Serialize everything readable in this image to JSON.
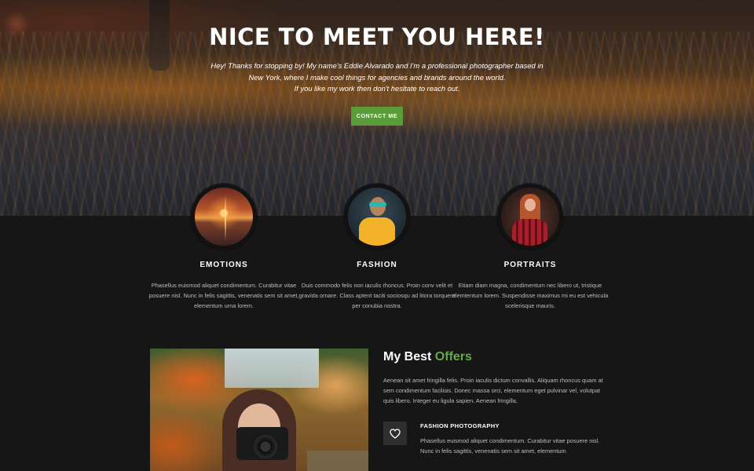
{
  "hero": {
    "title": "NICE TO MEET YOU HERE!",
    "text_lines": [
      "Hey! Thanks for stopping by! My name's Eddie Alvarado and I'm a professional photographer based in",
      "New York, where I make cool things for agencies and brands around the world.",
      "If you like my work then don't hesitate to reach out."
    ],
    "button_label": "CONTACT ME"
  },
  "features": [
    {
      "title": "EMOTIONS",
      "text": "Phasellus euismod aliquet condimentum. Curabitur vitae posuere nisl. Nunc in felis sagittis, venenatis sem sit amet, elementum urna lorem."
    },
    {
      "title": "FASHION",
      "text": "Duis commodo felis non iaculis rhoncus. Proin conv velit et gravida ornare. Class aptent taciti sociosqu ad litora torquent per conubia nostra."
    },
    {
      "title": "PORTRAITS",
      "text": "Etiam diam magna, condimentum nec libero ut, tristique elemtentum lorem. Suspendisse maximus mi eu est vehicula scelerisque mauris."
    }
  ],
  "offers": {
    "title_prefix": "My Best ",
    "title_accent": "Offers",
    "text": "Aenean sit amet fringilla felis. Proin iaculis dictum convallis. Aliquam rhoncus quam at sem condimentum facilisis. Donec massa orci, elementum eget pulvinar vel, volutpat quis libero. Integer eu ligula sapien. Aenean fringilla,",
    "service": {
      "icon": "heart-icon",
      "title": "FASHION PHOTOGRAPHY",
      "text": "Phasellus euismod aliquet condimentum. Curabitur vitae posuere nisl. Nunc in felis sagittis, venenatis sem sit amet, elementum"
    }
  },
  "colors": {
    "accent": "#67a84a",
    "button": "#5a9b3a",
    "background": "#161616"
  }
}
